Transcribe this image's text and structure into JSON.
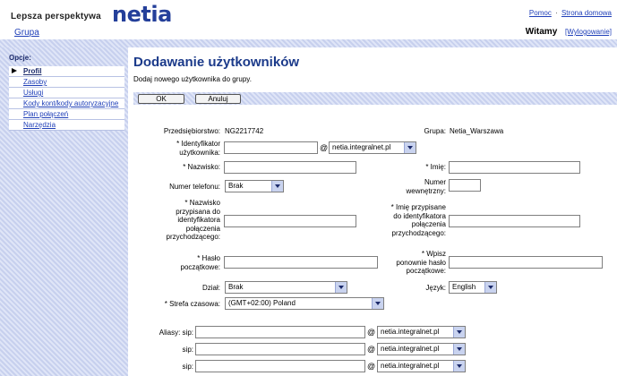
{
  "header": {
    "brand": "Lepsza perspektywa",
    "logo": "netia",
    "group_link": "Grupa",
    "help": "Pomoc",
    "home": "Strona domowa",
    "link_separator": "·",
    "welcome": "Witamy",
    "logout": "[Wylogowanie]"
  },
  "sidebar": {
    "heading": "Opcje:",
    "items": [
      {
        "label": "Profil",
        "active": true
      },
      {
        "label": "Zasoby"
      },
      {
        "label": "Usługi"
      },
      {
        "label": "Kody kont/kody autoryzacyjne"
      },
      {
        "label": "Plan połączeń"
      },
      {
        "label": "Narzędzia"
      }
    ]
  },
  "main": {
    "title": "Dodawanie użytkowników",
    "subtitle": "Dodaj nowego użytkownika do grupy.",
    "ok_label": "OK",
    "cancel_label": "Anuluj"
  },
  "form": {
    "provider_label": "Przedsiębiorstwo:",
    "provider_value": "NG2217742",
    "group_label": "Grupa:",
    "group_value": "Netia_Warszawa",
    "userid_label_1": "* Identyfikator",
    "userid_label_2": "użytkownika:",
    "userid_value": "",
    "at_symbol": "@",
    "domain_value": "netia.integralnet.pl",
    "lastname_label": "* Nazwisko:",
    "lastname_value": "",
    "firstname_label": "* Imię:",
    "firstname_value": "",
    "phone_label": "Numer telefonu:",
    "phone_value": "Brak",
    "ext_label_1": "Numer",
    "ext_label_2": "wewnętrzny:",
    "ext_value": "",
    "cid_last_label": [
      "* Nazwisko",
      "przypisana do",
      "identyfikatora",
      "połączenia",
      "przychodzącego:"
    ],
    "cid_last_value": "",
    "cid_first_label": [
      "* Imię przypisane",
      "do identyfikatora",
      "połączenia",
      "przychodzącego:"
    ],
    "cid_first_value": "",
    "password_label": [
      "* Hasło",
      "początkowe:"
    ],
    "password_value": "",
    "password2_label": [
      "* Wpisz",
      "ponownie hasło",
      "początkowe:"
    ],
    "password2_value": "",
    "department_label": "Dział:",
    "department_value": "Brak",
    "language_label": "Język:",
    "language_value": "English",
    "timezone_label": "* Strefa czasowa:",
    "timezone_value": "(GMT+02:00) Poland",
    "aliases_label": "Aliasy: sip:",
    "sip_label": "sip:",
    "alias_domains": [
      "netia.integralnet.pl",
      "netia.integralnet.pl",
      "netia.integralnet.pl"
    ]
  }
}
